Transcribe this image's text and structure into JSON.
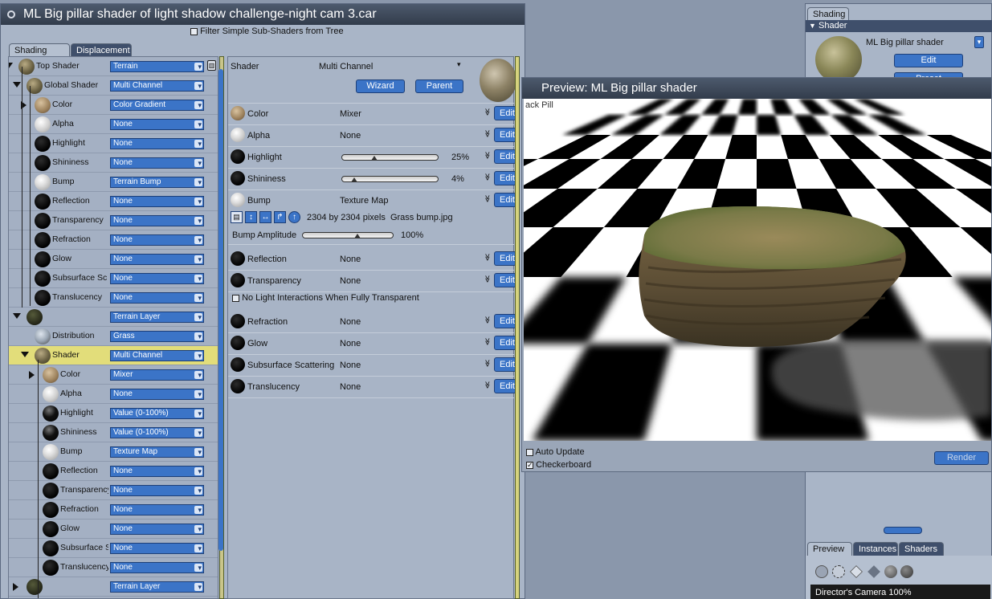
{
  "main_window": {
    "title": "ML Big pillar shader of light shadow challenge-night cam 3.car",
    "filter_label": "Filter Simple Sub-Shaders from Tree",
    "tabs": [
      "Shading",
      "Displacement"
    ]
  },
  "tree": {
    "rows": [
      {
        "label": "Top Shader",
        "value": "Terrain",
        "ball": "rock"
      },
      {
        "label": "Global Shader",
        "value": "Multi Channel",
        "ball": "rock"
      },
      {
        "label": "Color",
        "value": "Color Gradient",
        "ball": "tan"
      },
      {
        "label": "Alpha",
        "value": "None",
        "ball": "white"
      },
      {
        "label": "Highlight",
        "value": "None",
        "ball": "black"
      },
      {
        "label": "Shininess",
        "value": "None",
        "ball": "black"
      },
      {
        "label": "Bump",
        "value": "Terrain Bump",
        "ball": "bump"
      },
      {
        "label": "Reflection",
        "value": "None",
        "ball": "black"
      },
      {
        "label": "Transparency",
        "value": "None",
        "ball": "black"
      },
      {
        "label": "Refraction",
        "value": "None",
        "ball": "black"
      },
      {
        "label": "Glow",
        "value": "None",
        "ball": "black"
      },
      {
        "label": "Subsurface Sc",
        "value": "None",
        "ball": "black"
      },
      {
        "label": "Translucency",
        "value": "None",
        "ball": "black"
      },
      {
        "label": "",
        "value": "Terrain Layer",
        "ball": "dark"
      },
      {
        "label": "Distribution",
        "value": "Grass",
        "ball": "grass"
      },
      {
        "label": "Shader",
        "value": "Multi Channel",
        "ball": "rock"
      },
      {
        "label": "Color",
        "value": "Mixer",
        "ball": "tan"
      },
      {
        "label": "Alpha",
        "value": "None",
        "ball": "white"
      },
      {
        "label": "Highlight",
        "value": "Value (0-100%)",
        "ball": "shiny"
      },
      {
        "label": "Shininess",
        "value": "Value (0-100%)",
        "ball": "shiny"
      },
      {
        "label": "Bump",
        "value": "Texture Map",
        "ball": "bump"
      },
      {
        "label": "Reflection",
        "value": "None",
        "ball": "black"
      },
      {
        "label": "Transparency",
        "value": "None",
        "ball": "black"
      },
      {
        "label": "Refraction",
        "value": "None",
        "ball": "black"
      },
      {
        "label": "Glow",
        "value": "None",
        "ball": "black"
      },
      {
        "label": "Subsurface Sc",
        "value": "None",
        "ball": "black"
      },
      {
        "label": "Translucency",
        "value": "None",
        "ball": "black"
      },
      {
        "label": "",
        "value": "Terrain Layer",
        "ball": "dark"
      }
    ]
  },
  "channel_panel": {
    "header_label": "Shader",
    "header_value": "Multi Channel",
    "wizard_label": "Wizard",
    "parent_label": "Parent",
    "edit_label": "Edit",
    "rows": [
      {
        "label": "Color",
        "value": "Mixer",
        "ball": "tan"
      },
      {
        "label": "Alpha",
        "value": "None",
        "ball": "white"
      },
      {
        "label": "Highlight",
        "value": "25%",
        "slider": 0.25,
        "ball": "black"
      },
      {
        "label": "Shininess",
        "value": "4%",
        "slider": 0.04,
        "ball": "black"
      },
      {
        "label": "Bump",
        "value": "Texture Map",
        "ball": "bump"
      }
    ],
    "bump": {
      "texture_info": "2304 by 2304 pixels  Grass bump.jpg",
      "amplitude_label": "Bump Amplitude",
      "amplitude_value": "100%",
      "amplitude": 0.6
    },
    "rows2": [
      {
        "label": "Reflection",
        "value": "None"
      },
      {
        "label": "Transparency",
        "value": "None"
      }
    ],
    "no_light_label": "No Light Interactions When Fully Transparent",
    "rows3": [
      {
        "label": "Refraction",
        "value": "None"
      },
      {
        "label": "Glow",
        "value": "None"
      },
      {
        "label": "Subsurface Scattering",
        "value": "None"
      },
      {
        "label": "Translucency",
        "value": "None"
      }
    ]
  },
  "preview_window": {
    "title": "Preview: ML Big pillar shader",
    "overlay_text": "ack Pill",
    "auto_update_label": "Auto Update",
    "checkerboard_label": "Checkerboard",
    "render_label": "Render"
  },
  "right_panel": {
    "tab": "Shading",
    "section": "Shader",
    "shader_name": "ML Big pillar shader",
    "edit_label": "Edit",
    "preset_label": "Preset",
    "bottom_tabs": [
      "Preview",
      "Instances",
      "Shaders"
    ],
    "camera_label": "Director's Camera 100%"
  }
}
